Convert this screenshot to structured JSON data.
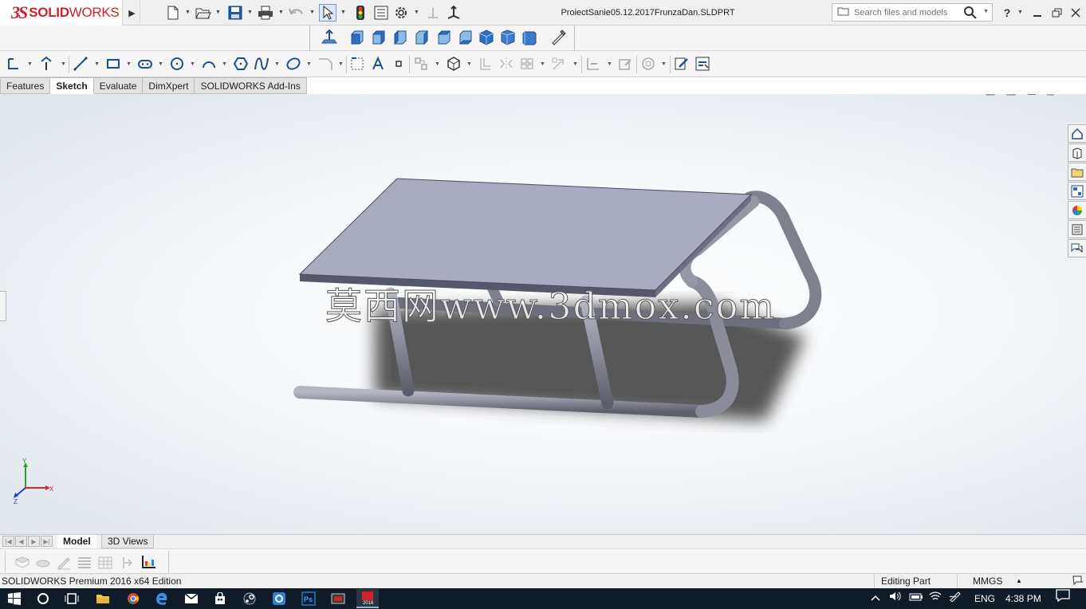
{
  "app": {
    "brand_ds": "3S",
    "brand_solid": "SOLID",
    "brand_works": "WORKS",
    "document_title": "ProiectSanie05.12.2017FrunzaDan.SLDPRT"
  },
  "search": {
    "placeholder": "Search files and models"
  },
  "window_controls": {
    "help": "?"
  },
  "command_tabs": [
    {
      "label": "Features"
    },
    {
      "label": "Sketch"
    },
    {
      "label": "Evaluate"
    },
    {
      "label": "DimXpert"
    },
    {
      "label": "SOLIDWORKS Add-Ins"
    }
  ],
  "graphics": {
    "watermark": "莫西网www.3dmox.com",
    "triad": {
      "y": "Y",
      "x": "X",
      "z": "Z"
    }
  },
  "bottom_tabs": [
    {
      "label": "Model"
    },
    {
      "label": "3D Views"
    }
  ],
  "status": {
    "edition": "SOLIDWORKS Premium 2016 x64 Edition",
    "mode": "Editing Part",
    "units": "MMGS"
  },
  "taskbar": {
    "language": "ENG",
    "time": "4:38 PM",
    "solidworks_badge": "2016"
  },
  "colors": {
    "brand_red": "#d3202a",
    "model_top": "#a9abc3",
    "model_tube": "#8f929e",
    "taskbar_bg": "#101b28"
  }
}
